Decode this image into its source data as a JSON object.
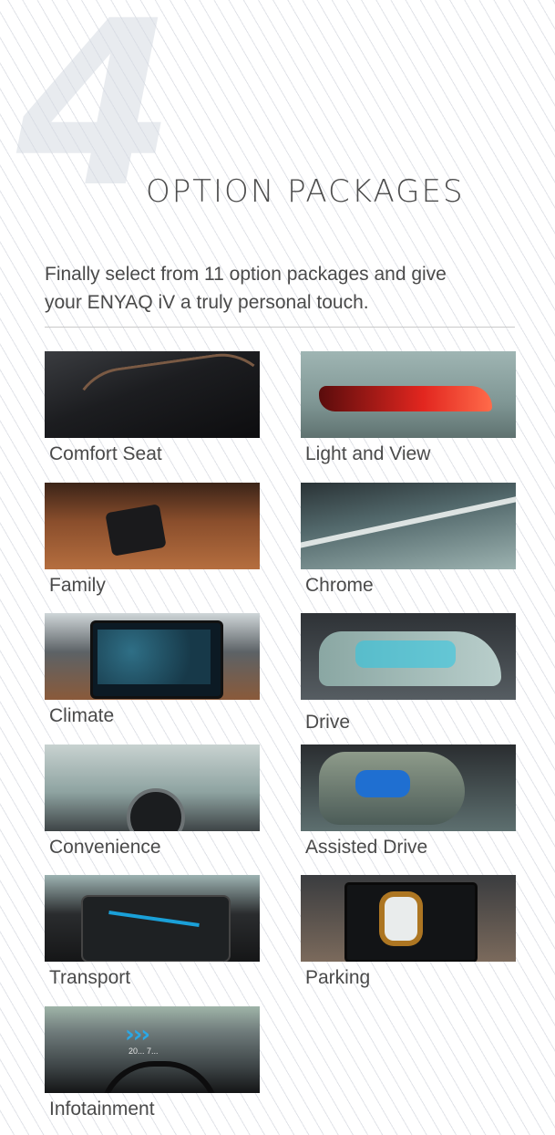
{
  "section": {
    "number": "4",
    "title": "OPTION PACKAGES",
    "intro_line1": "Finally select from 11 option packages and give",
    "intro_line2": "your ENYAQ iV a truly personal touch."
  },
  "packages": [
    {
      "label": "Comfort Seat"
    },
    {
      "label": "Light and View"
    },
    {
      "label": "Family"
    },
    {
      "label": "Chrome"
    },
    {
      "label": "Climate"
    },
    {
      "label": "Drive"
    },
    {
      "label": "Convenience"
    },
    {
      "label": "Assisted Drive"
    },
    {
      "label": "Transport"
    },
    {
      "label": "Parking"
    },
    {
      "label": "Infotainment"
    }
  ],
  "infotainment_hud": {
    "arrows": "›››",
    "readout": "20... 7..."
  }
}
